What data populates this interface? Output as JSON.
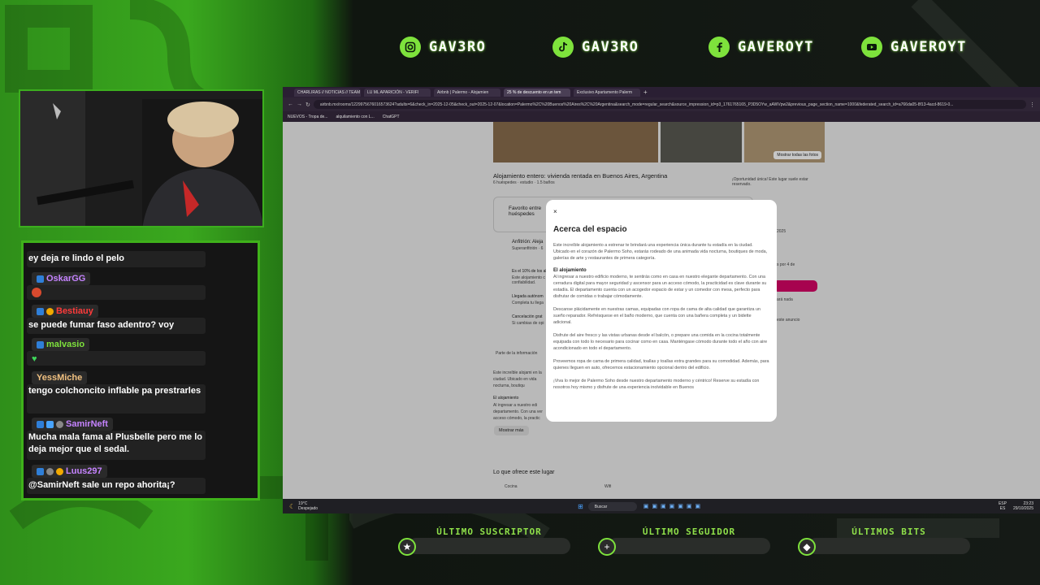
{
  "socials": [
    {
      "icon": "instagram-icon",
      "label": "GAV3RO"
    },
    {
      "icon": "tiktok-icon",
      "label": "GAV3RO"
    },
    {
      "icon": "facebook-icon",
      "label": "GAVEROYT"
    },
    {
      "icon": "youtube-icon",
      "label": "GAVEROYT"
    }
  ],
  "chat": {
    "messages": [
      {
        "user": "",
        "text": "ey deja re lindo el pelo"
      },
      {
        "user": "OskarGG",
        "color": "#c583ff",
        "text": ""
      },
      {
        "user": "Bestiauy",
        "color": "#ff3b3b",
        "text": "se puede fumar faso adentro? voy"
      },
      {
        "user": "malvasio",
        "color": "#7ee23c",
        "text": ""
      },
      {
        "user": "YessMiche",
        "color": "#f0c080",
        "text": "tengo colchoncito inflable pa prestrarles"
      },
      {
        "user": "SamirNeft",
        "color": "#c583ff",
        "text": "Mucha mala fama al Plusbelle pero me lo deja mejor que el sedal."
      },
      {
        "user": "Luus297",
        "color": "#c583ff",
        "text": "@SamirNeft sale un repo ahorita¡?"
      }
    ]
  },
  "browser": {
    "tabs": [
      "CHARLIRAS // NOTICIAS // TEAM",
      "LU ML APARICIÓN - VERIFI",
      "Airbnb | Palermo - Alojamien",
      "25 % de descuento en un tem",
      "Exclusivo Apartamento Palerm"
    ],
    "url": "airbnb.mx/rooms/1229975676016573624?adults=6&check_in=2025-12-05&check_out=2025-12-07&location=Palermo%2C%20Buenos%20Aires%2C%20Argentina&search_mode=regular_search&source_impression_id=p3_1761765165_P3D5OYw_aAWVpw2&previous_page_section_name=1000&federated_search_id=a766da05-8f13-4acd-8619-0...",
    "bookmarks": [
      "NUEVOS - Tropa de...",
      "alquilamiento con L...",
      "ChatGPT"
    ],
    "show_photos": "Mostrar todas las fotos",
    "listing_title": "Alojamiento entero: vivienda rentada en Buenos Aires, Argentina",
    "listing_sub": "6 huéspedes · estudio · 1.5 baños",
    "favorite": "Favorito entre huéspedes",
    "rare_find": "¡Oportunidad única! Este lugar suele estar reservado.",
    "host": "Anfitrión: Aleja",
    "host_sub": "Superanfitrión · 6",
    "feat1": "Es el 10% de los al",
    "feat1_sub": "Este alojamiento c confiabilidad.",
    "feat2": "Llegada autónom",
    "feat2_sub": "Completa tu llega",
    "feat3": "Cancelación grat",
    "feat3_sub": "Si cambias de opi",
    "translated": "Parte de la información",
    "desc_snip": "Este increíble alojami en la ciudad. Ubicado en vida nocturna, boutiqu",
    "el_aloj": "El alojamiento",
    "desc_snip2": "Al ingresar a nuestro edi departamento. Con una ver acceso cómodo, la practic",
    "show_more": "Mostrar más",
    "offers": "Lo que ofrece este lugar",
    "amenity1": "Cocina",
    "amenity2": "Wifi",
    "side1": "2025",
    "side2": "s por 4 de",
    "side3": "ará nada",
    "side4": "este anuncio"
  },
  "modal": {
    "close": "×",
    "title": "Acerca del espacio",
    "p1": "Este increíble alojamiento a estrenar te brindará una experiencia única durante tu estadía en la ciudad. Ubicado en el corazón de Palermo Soho, estarás rodeado de una animada vida nocturna, boutiques de moda, galerías de arte y restaurantes de primera categoría.",
    "h1": "El alojamiento",
    "p2": "Al ingresar a nuestro edificio moderno, te sentirás como en casa en nuestro elegante departamento. Con una cerradura digital para mayor seguridad y ascensor para un acceso cómodo, la practicidad es clave durante su estadía. El departamento cuenta con un acogedor espacio de estar y un comedor con mesa, perfecto para disfrutar de comidas o trabajar cómodamente.",
    "p3": "Descanse plácidamente en nuestras camas, equipadas con ropa de cama de alta calidad que garantiza un sueño reparador. Refrésquese en el baño moderno, que cuenta con una bañera completa y un bidette adicional.",
    "p4": "Disfrute del aire fresco y las vistas urbanas desde el balcón, o prepare una comida en la cocina totalmente equipada con todo lo necesario para cocinar como en casa. Manténgase cómodo durante todo el año con aire acondicionado en todo el departamento.",
    "p5": "Proveemos ropa de cama de primera calidad, toallas y toallas extra grandes para su comodidad. Además, para quienes lleguen en auto, ofrecemos estacionamiento opcional dentro del edificio.",
    "p6": "¡Viva lo mejor de Palermo Soho desde nuestro departamento moderno y céntrico! Reserve su estadía con nosotros hoy mismo y disfrute de una experiencia inolvidable en Buenos"
  },
  "taskbar": {
    "weather": "19°C",
    "weather_sub": "Despejado",
    "search": "Buscar",
    "lang": "ESP",
    "lang2": "ES",
    "time": "23:23",
    "date": "29/10/2025"
  },
  "bottom": [
    {
      "label": "ÚLTIMO SUSCRIPTOR",
      "icon": "star-icon",
      "glyph": "★"
    },
    {
      "label": "ÚLTIMO SEGUIDOR",
      "icon": "plus-icon",
      "glyph": "+"
    },
    {
      "label": "ÚLTIMOS BITS",
      "icon": "bits-icon",
      "glyph": "◆"
    }
  ]
}
